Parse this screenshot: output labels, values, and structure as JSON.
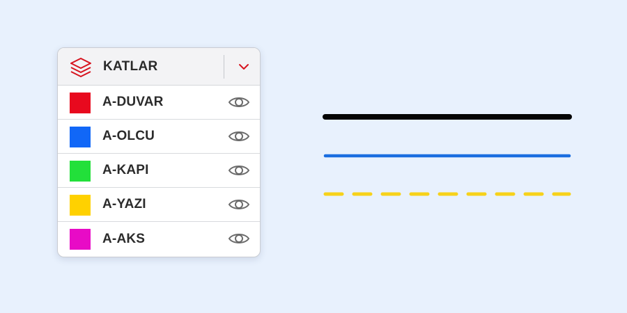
{
  "panel": {
    "title": "KATLAR",
    "header_icon": "layers-icon",
    "dropdown_icon": "chevron-down-icon",
    "accent_color": "#d7141f"
  },
  "layers": [
    {
      "name": "A-DUVAR",
      "color": "#e8091e",
      "visible": true,
      "icon": "eye-icon"
    },
    {
      "name": "A-OLCU",
      "color": "#1167f7",
      "visible": true,
      "icon": "eye-icon"
    },
    {
      "name": "A-KAPI",
      "color": "#22e03a",
      "visible": true,
      "icon": "eye-icon"
    },
    {
      "name": "A-YAZI",
      "color": "#ffd100",
      "visible": true,
      "icon": "eye-icon"
    },
    {
      "name": "A-AKS",
      "color": "#e80bc6",
      "visible": true,
      "icon": "eye-icon"
    }
  ],
  "canvas": {
    "lines": [
      {
        "style": "solid",
        "color": "#050505"
      },
      {
        "style": "solid",
        "color": "#1a6ee0"
      },
      {
        "style": "dashed",
        "color": "#f7d21a"
      }
    ]
  },
  "colors": {
    "background": "#e8f1fd",
    "panel_header": "#f3f3f5",
    "eye_icon": "#6b6b6b"
  }
}
